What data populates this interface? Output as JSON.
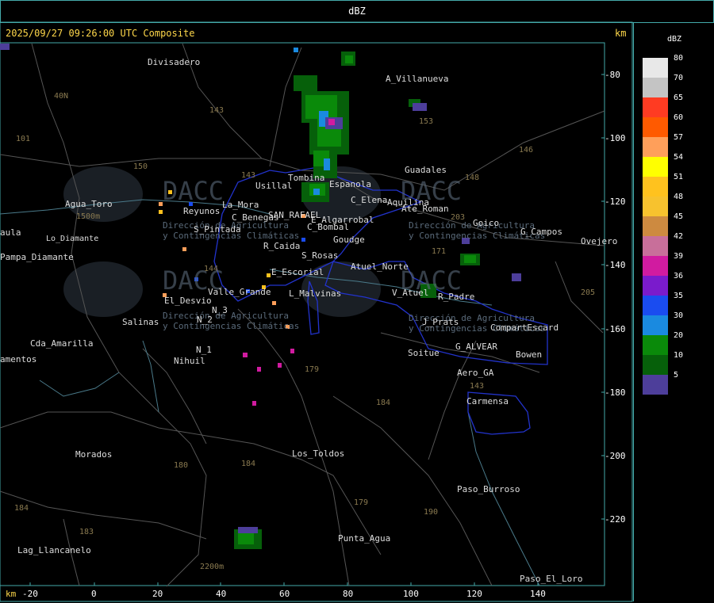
{
  "header": {
    "title": "dBZ"
  },
  "timestamp": "2025/09/27 09:26:00 UTC Composite",
  "units": {
    "km_top": "km",
    "km_bottom": "km"
  },
  "legend": {
    "title": "dBZ",
    "items": [
      {
        "label": "80",
        "color": "#e8e8e8"
      },
      {
        "label": "70",
        "color": "#c4c4c4"
      },
      {
        "label": "65",
        "color": "#ff3b22"
      },
      {
        "label": "60",
        "color": "#ff5a00"
      },
      {
        "label": "57",
        "color": "#ff9f5a"
      },
      {
        "label": "54",
        "color": "#ffff00"
      },
      {
        "label": "51",
        "color": "#ffc21e"
      },
      {
        "label": "48",
        "color": "#f7c22e"
      },
      {
        "label": "45",
        "color": "#cd8a40"
      },
      {
        "label": "42",
        "color": "#c86f9a"
      },
      {
        "label": "39",
        "color": "#d11ba0"
      },
      {
        "label": "36",
        "color": "#7a1bcc"
      },
      {
        "label": "35",
        "color": "#1a4cf0"
      },
      {
        "label": "30",
        "color": "#1a8ae0"
      },
      {
        "label": "20",
        "color": "#0a8a0a"
      },
      {
        "label": "10",
        "color": "#06600a"
      },
      {
        "label": "5",
        "color": "#4d3e9a"
      }
    ]
  },
  "y_axis": [
    "-80",
    "-100",
    "-120",
    "-140",
    "-160",
    "-180",
    "-200",
    "-220"
  ],
  "x_axis": [
    "-20",
    "0",
    "20",
    "40",
    "60",
    "80",
    "100",
    "120",
    "140"
  ],
  "places": [
    "Divisadero",
    "A_Villanueva",
    "Guadales",
    "Usillal",
    "Tombina",
    "Espanola",
    "C_Elena",
    "Aguilina",
    "Ate_Roman",
    "Agua_Toro",
    "Reyunos",
    "La_Mora",
    "San_Rafael",
    "Cuadro_Benegas",
    "El_Algarrobal",
    "Cuadro_Bombal",
    "Goudge",
    "Rama_Caida",
    "Pintada",
    "Cerro_Nevado",
    "Pampa_Diamante",
    "S_Rosas",
    "Atuel_Norte",
    "El_Escorial",
    "L_Malvinas",
    "V_Atuel",
    "R_Padre",
    "Valle_Grande",
    "El_Desvio",
    "N_3",
    "N_2",
    "N_1",
    "Salinas",
    "Cda_Amarilla",
    "Nihuil",
    "J_Prats",
    "CompartEscard",
    "G_ALVEAR",
    "Bowen",
    "Soitue",
    "Aero_GA",
    "Carmensa",
    "Goico",
    "G_Campos",
    "Ovejero",
    "Morados",
    "Los_Toldos",
    "Paso_Burroso",
    "Punta_Agua",
    "Lag_Llancanelo",
    "Paso_El_Loro",
    "Amenitos",
    "Laula",
    "Lo_Diamante"
  ],
  "place_labels": {
    "Divisadero": "Divisadero",
    "A_Villanueva": "A_Villanueva",
    "Guadales": "Guadales",
    "Usillal": "Usillal",
    "Tombina": "Tombina",
    "Espanola": "Espanola",
    "C_Elena": "C_Elena",
    "Aguilina": "Aquilina",
    "Ate_Roman": "Ate_Roman",
    "Agua_Toro": "Agua_Toro",
    "Reyunos": "Reyunos",
    "La_Mora": "La_Mora",
    "San_Rafael": "SAN_RAFAEL",
    "Cuadro_Benegas": "C_Benegas",
    "El_Algarrobal": "E_Algarrobal",
    "Cuadro_Bombal": "C_Bombal",
    "Goudge": "Goudge",
    "Rama_Caida": "R_Caida",
    "Pintada": "S_Pintada",
    "Cerro_Nevado": "1500m",
    "Pampa_Diamante": "Pampa_Diamante",
    "S_Rosas": "S_Rosas",
    "Atuel_Norte": "Atuel_Norte",
    "El_Escorial": "E_Escorial",
    "L_Malvinas": "L_Malvinas",
    "V_Atuel": "V_Atuel",
    "R_Padre": "R_Padre",
    "Valle_Grande": "Valle_Grande",
    "El_Desvio": "El_Desvio",
    "N_3": "N_3",
    "N_2": "N_2",
    "N_1": "N_1",
    "Salinas": "Salinas",
    "Cda_Amarilla": "Cda_Amarilla",
    "Nihuil": "Nihuil",
    "J_Prats": "J_Prats",
    "CompartEscard": "CompartEscard",
    "G_ALVEAR": "G_ALVEAR",
    "Bowen": "Bowen",
    "Soitue": "Soitue",
    "Aero_GA": "Aero_GA",
    "Carmensa": "Carmensa",
    "Goico": "Goico",
    "G_Campos": "G_Campos",
    "Ovejero": "Ovejero",
    "Morados": "Morados",
    "Los_Toldos": "Los_Toldos",
    "Paso_Burroso": "Paso_Burroso",
    "Punta_Agua": "Punta_Agua",
    "Lag_Llancanelo": "Lag_Llancanelo",
    "Paso_El_Loro": "Paso_El_Loro",
    "Amenitos": "amentos",
    "Laula": "aula",
    "Lo_Diamante": "Lo_Diamante"
  },
  "routes": [
    "143",
    "153",
    "146",
    "148",
    "150",
    "40N",
    "101",
    "143",
    "203",
    "171",
    "144",
    "179",
    "184",
    "180",
    "184",
    "183",
    "179",
    "190",
    "143",
    "205",
    "184",
    "2200m"
  ],
  "watermark": {
    "brand": "DACC",
    "line1": "Dirección de Agricultura",
    "line2": "y Contingencias Climáticas"
  }
}
